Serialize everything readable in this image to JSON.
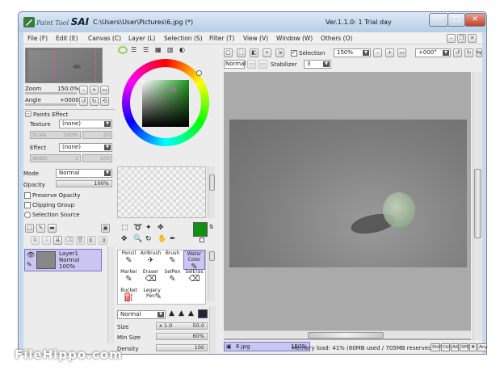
{
  "window": {
    "brand_prefix": "Paint Tool",
    "brand_name": "SAI",
    "file_path": "C:\\Users\\User\\Pictures\\6.jpg (*)",
    "version": "Ver.1.1.0: 1 Trial day",
    "controls": {
      "minimize": "—",
      "maximize": "□",
      "close": "✕"
    }
  },
  "menubar": [
    "File (F)",
    "Edit (E)",
    "Canvas (C)",
    "Layer (L)",
    "Selection (S)",
    "Filter (T)",
    "View (V)",
    "Window (W)",
    "Others (O)"
  ],
  "navigator": {
    "zoom_label": "Zoom",
    "zoom_value": "150.0%",
    "angle_label": "Angle",
    "angle_value": "+0000"
  },
  "paint_effect": {
    "header": "Paints Effect",
    "texture_label": "Texture",
    "texture_value": "(none)",
    "scale_label": "Scale",
    "scale_value": "100%",
    "scale_num": "20",
    "effect_label": "Effect",
    "effect_value": "(none)",
    "width_label": "Width",
    "width_value": "1",
    "width_num": "100"
  },
  "layer_props": {
    "mode_label": "Mode",
    "mode_value": "Normal",
    "opacity_label": "Opacity",
    "opacity_value": "100%",
    "preserve_opacity": "Preserve Opacity",
    "clipping_group": "Clipping Group",
    "selection_source": "Selection Source"
  },
  "layer": {
    "name": "Layer1",
    "mode": "Normal",
    "opacity": "100%"
  },
  "color": {
    "primary": "#129012",
    "hue_ring": true,
    "square_color": "#1f9a1f"
  },
  "tools": [
    {
      "label": "Pencil",
      "icon": "✎"
    },
    {
      "label": "AirBrush",
      "icon": "✈"
    },
    {
      "label": "Brush",
      "icon": "🖌"
    },
    {
      "label": "Water Color",
      "icon": "✎"
    },
    {
      "label": "Marker",
      "icon": "✎"
    },
    {
      "label": "Eraser",
      "icon": "⌫"
    },
    {
      "label": "SelPen",
      "icon": "✎"
    },
    {
      "label": "SelEras",
      "icon": "⌫"
    },
    {
      "label": "Bucket",
      "icon": "⛽"
    },
    {
      "label": "Legacy Pen",
      "icon": "✎"
    }
  ],
  "brush": {
    "mode_value": "Normal",
    "size_label": "Size",
    "size_mult": "x 1.0",
    "size_value": "50.0",
    "min_size_label": "Min Size",
    "min_size_value": "60%",
    "density_label": "Density",
    "density_value": "100"
  },
  "canvas_toolbar": {
    "selection_label": "Selection",
    "zoom_value": "150%",
    "angle_value": "+000°",
    "mode_value": "Normal",
    "stabilizer_label": "Stabilizer",
    "stabilizer_value": "3"
  },
  "document_tab": {
    "name": "6.jpg",
    "zoom": "150%"
  },
  "status": {
    "memory": "Memory load: 41% (80MB used / 705MB reserved)",
    "keys": [
      "Shift",
      "Ctrl",
      "Alt",
      "SPC",
      "✥",
      "Any",
      "✎"
    ]
  },
  "watermark": "FileHippo.com"
}
